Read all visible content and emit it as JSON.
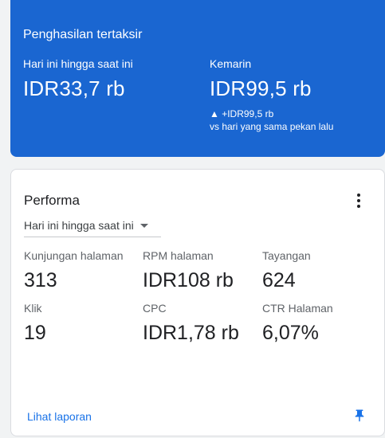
{
  "earnings": {
    "title": "Penghasilan tertaksir",
    "today_label": "Hari ini hingga saat ini",
    "today_value": "IDR33,7 rb",
    "yesterday_label": "Kemarin",
    "yesterday_value": "IDR99,5 rb",
    "delta_text": "▲ +IDR99,5 rb",
    "delta_sub": "vs hari yang sama pekan lalu"
  },
  "performance": {
    "title": "Performa",
    "range_selected": "Hari ini hingga saat ini",
    "metrics": [
      {
        "label": "Kunjungan halaman",
        "value": "313"
      },
      {
        "label": "RPM halaman",
        "value": "IDR108 rb"
      },
      {
        "label": "Tayangan",
        "value": "624"
      },
      {
        "label": "Klik",
        "value": "19"
      },
      {
        "label": "CPC",
        "value": "IDR1,78 rb"
      },
      {
        "label": "CTR Halaman",
        "value": "6,07%"
      }
    ],
    "report_link": "Lihat laporan",
    "icons": {
      "menu": "more-vert-icon",
      "pin": "pin-icon",
      "dropdown": "caret-down-icon"
    }
  },
  "colors": {
    "accent": "#1a66d1",
    "link": "#1a73e8",
    "background": "#f1f3f4"
  }
}
